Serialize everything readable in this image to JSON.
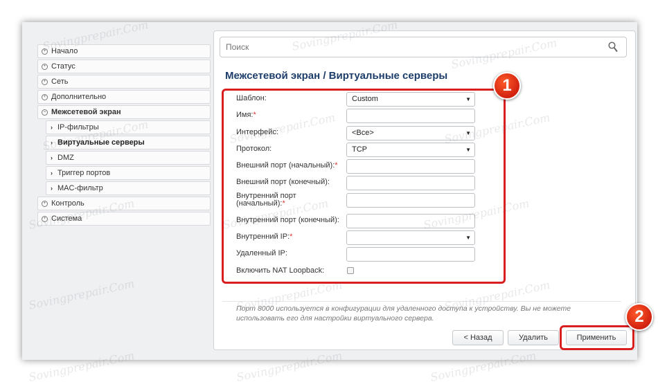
{
  "sidebar": {
    "items": [
      {
        "label": "Начало",
        "icon": "plus-circle-icon"
      },
      {
        "label": "Статус",
        "icon": "plus-circle-icon"
      },
      {
        "label": "Сеть",
        "icon": "plus-circle-icon"
      },
      {
        "label": "Дополнительно",
        "icon": "plus-circle-icon"
      },
      {
        "label": "Межсетевой экран",
        "icon": "minus-circle-icon"
      }
    ],
    "subitems": [
      {
        "label": "IP-фильтры"
      },
      {
        "label": "Виртуальные серверы"
      },
      {
        "label": "DMZ"
      },
      {
        "label": "Триггер портов"
      },
      {
        "label": "MAC-фильтр"
      }
    ],
    "items_after": [
      {
        "label": "Контроль"
      },
      {
        "label": "Система"
      }
    ]
  },
  "search": {
    "placeholder": "Поиск"
  },
  "page": {
    "title": "Межсетевой экран /  Виртуальные серверы"
  },
  "form": {
    "template": {
      "label": "Шаблон:",
      "value": "Custom"
    },
    "name": {
      "label": "Имя:",
      "value": ""
    },
    "interface": {
      "label": "Интерфейс:",
      "value": "<Все>"
    },
    "protocol": {
      "label": "Протокол:",
      "value": "TCP"
    },
    "ext_port_start": {
      "label": "Внешний порт (начальный):",
      "value": ""
    },
    "ext_port_end": {
      "label": "Внешний порт (конечный):",
      "value": ""
    },
    "int_port_start": {
      "label": "Внутренний порт (начальный):",
      "value": ""
    },
    "int_port_end": {
      "label": "Внутренний порт (конечный):",
      "value": ""
    },
    "internal_ip": {
      "label": "Внутренний IP:",
      "value": ""
    },
    "remote_ip": {
      "label": "Удаленный IP:",
      "value": ""
    },
    "nat_loopback": {
      "label": "Включить NAT Loopback:",
      "checked": false
    }
  },
  "note": "Порт 8000 используется в конфигурации для удаленного доступа к устройству. Вы не можете использовать его для настройки виртуального сервера.",
  "note_port": "8000",
  "buttons": {
    "back": "< Назад",
    "delete": "Удалить",
    "apply": "Применить"
  },
  "badges": {
    "one": "1",
    "two": "2"
  },
  "watermark": "Sovingprepair.Com",
  "colors": {
    "highlight": "#d81e1e",
    "title": "#1d3d6b"
  }
}
